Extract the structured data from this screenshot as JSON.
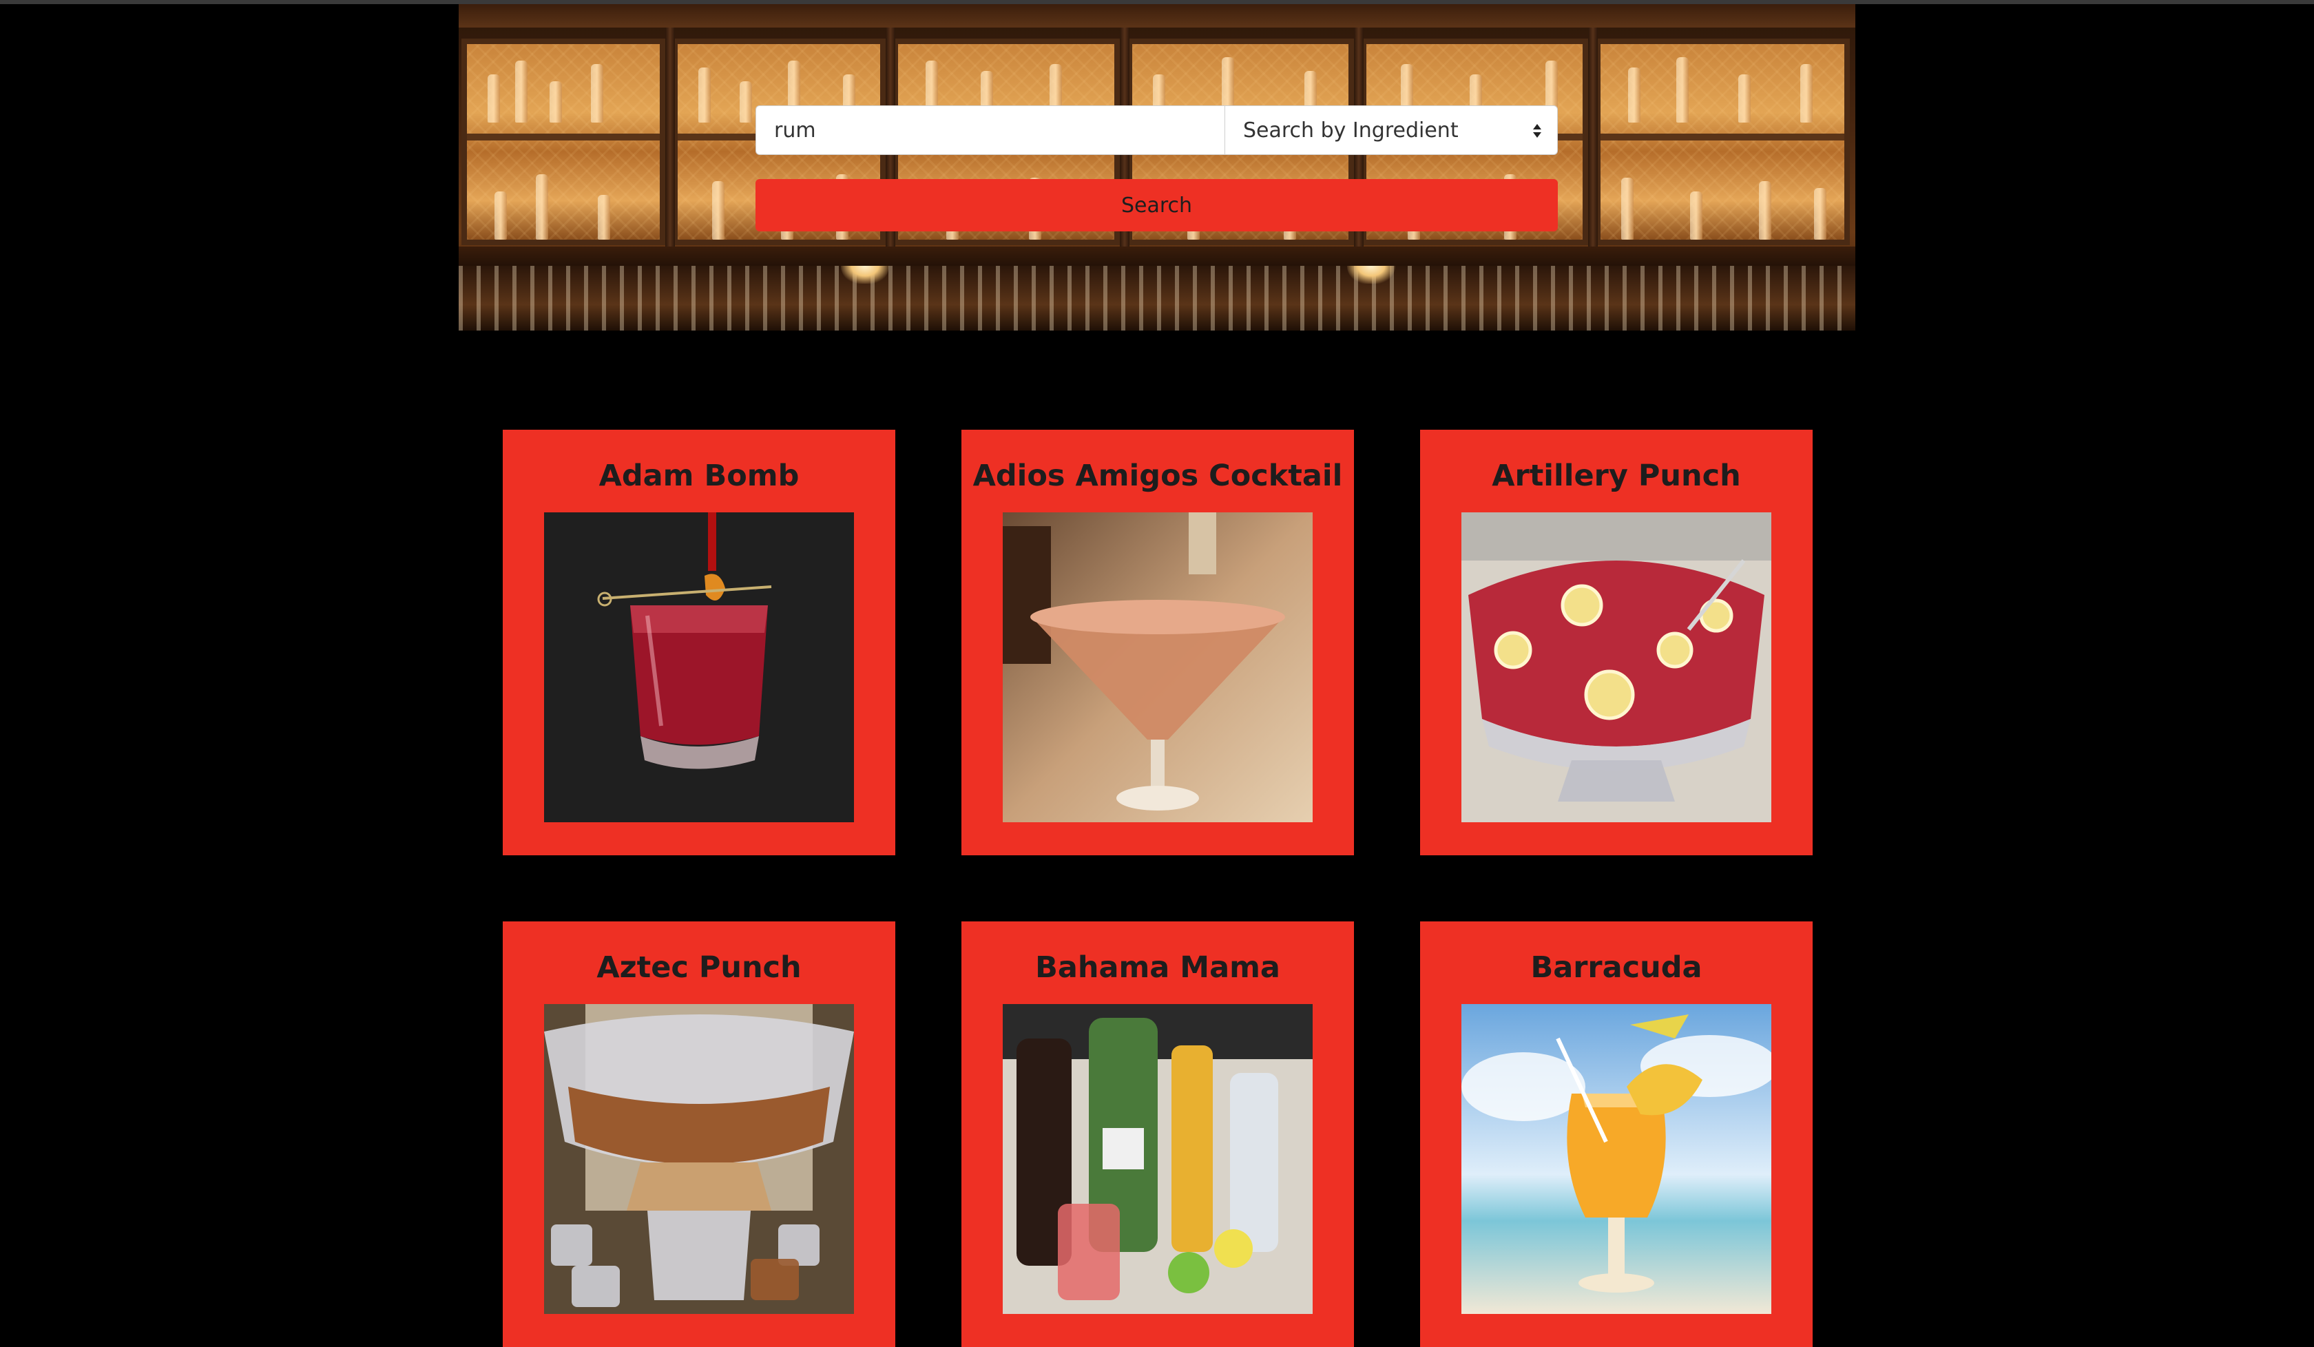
{
  "search": {
    "query_value": "rum",
    "mode_selected": "Search by Ingredient",
    "button_label": "Search"
  },
  "drinks": [
    {
      "name": "Adam Bomb",
      "image_icon": "cocktail-rocks-glass-photo"
    },
    {
      "name": "Adios Amigos Cocktail",
      "image_icon": "martini-glass-photo"
    },
    {
      "name": "Artillery Punch",
      "image_icon": "punch-bowl-photo"
    },
    {
      "name": "Aztec Punch",
      "image_icon": "crystal-punch-bowl-photo"
    },
    {
      "name": "Bahama Mama",
      "image_icon": "bottles-and-glass-photo"
    },
    {
      "name": "Barracuda",
      "image_icon": "hurricane-glass-photo"
    }
  ],
  "colors": {
    "accent": "#ee3024",
    "background": "#000000",
    "title_text": "#1d1d1d"
  }
}
